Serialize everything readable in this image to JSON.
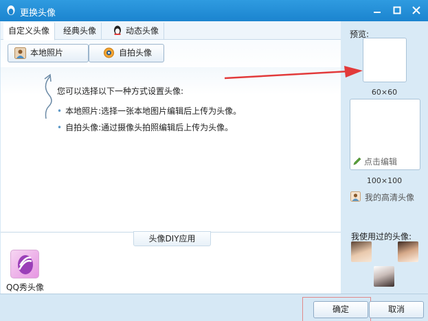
{
  "window": {
    "title": "更换头像"
  },
  "tabs": [
    {
      "label": "自定义头像"
    },
    {
      "label": "经典头像"
    },
    {
      "label": "动态头像"
    }
  ],
  "actions": {
    "local_photo": "本地照片",
    "selfie": "自拍头像"
  },
  "hints": {
    "title": "您可以选择以下一种方式设置头像:",
    "items": [
      "本地照片:选择一张本地图片编辑后上传为头像。",
      "自拍头像:通过摄像头拍照编辑后上传为头像。"
    ]
  },
  "diy": {
    "label": "头像DIY应用"
  },
  "qq_show": {
    "label": "QQ秀头像"
  },
  "preview": {
    "label": "预览:",
    "size_small": "60×60",
    "edit_label": "点击编辑",
    "size_large": "100×100",
    "hd_label": "我的高清头像",
    "used_label": "我使用过的头像:"
  },
  "buttons": {
    "ok": "确定",
    "cancel": "取消"
  },
  "colors": {
    "titlebar": "#1b84cf",
    "accent_arrow": "#e23a3a"
  }
}
